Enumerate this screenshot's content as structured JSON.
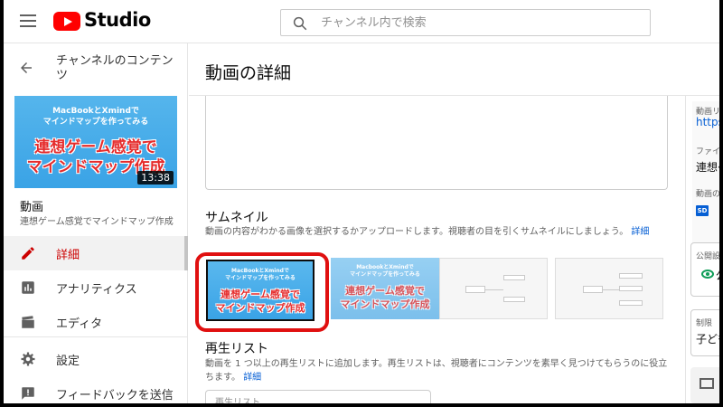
{
  "app": {
    "brand": "Studio",
    "search_placeholder": "チャンネル内で検索"
  },
  "sidebar": {
    "back_label": "チャンネルのコンテンツ",
    "thumb": {
      "line1": "MacBookとXmindで",
      "line2": "マインドマップを作ってみる",
      "big1": "連想ゲーム感覚で",
      "big2": "マインドマップ作成",
      "duration": "13:38"
    },
    "video_label": "動画",
    "video_title": "連想ゲーム感覚でマインドマップ作成",
    "items": [
      {
        "label": "詳細",
        "icon": "pencil-icon",
        "active": true
      },
      {
        "label": "アナリティクス",
        "icon": "analytics-icon",
        "active": false
      },
      {
        "label": "エディタ",
        "icon": "clapperboard-icon",
        "active": false
      },
      {
        "label": "設定",
        "icon": "gear-icon",
        "active": false
      },
      {
        "label": "フィードバックを送信",
        "icon": "feedback-icon",
        "active": false
      }
    ]
  },
  "main": {
    "title": "動画の詳細",
    "thumbnail_section": {
      "heading": "サムネイル",
      "description": "動画の内容がわかる画像を選択するかアップロードします。視聴者の目を引くサムネイルにしましょう。",
      "link": "詳細",
      "options": [
        {
          "line1": "MacBookとXmindで",
          "line2": "マインドマップを作ってみる",
          "big1": "連想ゲーム感覚で",
          "big2": "マインドマップ作成"
        },
        {
          "line1": "MacbookとXmindで",
          "line2": "マインドマップを作ってみる",
          "big1": "連想ゲーム感覚で",
          "big2": "マインドマップ作成"
        }
      ]
    },
    "playlist_section": {
      "heading": "再生リスト",
      "description": "動画を 1 つ以上の再生リストに追加します。再生リストは、視聴者にコンテンツを素早く見つけてもらうのに役立ちます。",
      "link": "詳細",
      "select_placeholder": "再生リスト"
    }
  },
  "right_panel": {
    "video_link_label": "動画リ",
    "video_link": "https:/",
    "filename_label": "ファイル",
    "filename": "連想ゲ",
    "quality_label": "動画の画",
    "quality_badge": "SD",
    "visibility_label": "公開設定",
    "visibility_value": "公",
    "restriction_label": "制限",
    "restriction_value": "子ども"
  },
  "colors": {
    "accent_red": "#cc0000",
    "link_blue": "#065fd4",
    "highlight_red": "#e01010"
  }
}
